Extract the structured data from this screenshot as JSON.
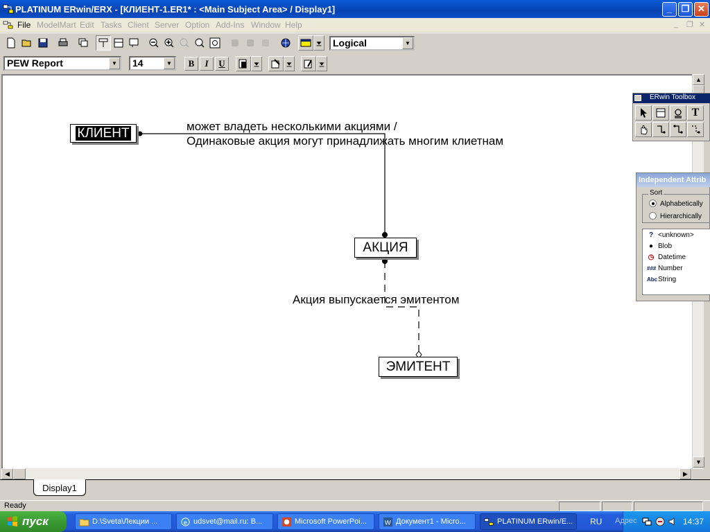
{
  "window": {
    "title": "PLATINUM ERwin/ERX - [КЛИЕНТ-1.ER1* : <Main Subject Area> / Display1]",
    "buttons": {
      "minimize": "_",
      "restore": "❐",
      "close": "✕"
    }
  },
  "menu": {
    "items": [
      "File",
      "ModelMart",
      "Edit",
      "Tasks",
      "Client",
      "Server",
      "Option",
      "Add-Ins",
      "Window",
      "Help"
    ],
    "active_index": 0
  },
  "toolbar": {
    "view_level": "Logical"
  },
  "format_toolbar": {
    "font_name": "PEW Report",
    "font_size": "14",
    "bold": "B",
    "italic": "I",
    "underline": "U"
  },
  "diagram": {
    "entities": [
      {
        "name": "КЛИЕНТ",
        "selected": true
      },
      {
        "name": "АКЦИЯ",
        "selected": false
      },
      {
        "name": "ЭМИТЕНТ",
        "selected": false
      }
    ],
    "relationships": [
      {
        "label_line1": "может владеть несколькими акциями /",
        "label_line2": "Одинаковые акция могут принадлижать многим клиетнам"
      },
      {
        "label_line1": "Акция выпускается эмитентом"
      }
    ]
  },
  "tabs": {
    "display": "Display1"
  },
  "status": {
    "text": "Ready"
  },
  "toolbox": {
    "title": "ERwin Toolbox",
    "text_tool": "T"
  },
  "attr_palette": {
    "title": "Independent Attrib",
    "sort_label": "Sort",
    "options": [
      "Alphabetically",
      "Hierarchically"
    ],
    "selected_option": 0,
    "domains": [
      {
        "icon": "?",
        "label": "<unknown>"
      },
      {
        "icon": "●",
        "label": "Blob"
      },
      {
        "icon": "◷",
        "label": "Datetime"
      },
      {
        "icon": "###",
        "label": "Number"
      },
      {
        "icon": "Abc",
        "label": "String"
      }
    ]
  },
  "taskbar": {
    "start_label": "пуск",
    "tasks": [
      {
        "label": "D:\\Sveta\\Лекции ...",
        "active": false
      },
      {
        "label": "udsvet@mail.ru: В...",
        "active": false
      },
      {
        "label": "Microsoft PowerPoi...",
        "active": false
      },
      {
        "label": "Документ1 - Micro...",
        "active": false
      },
      {
        "label": "PLATINUM ERwin/E...",
        "active": true
      }
    ],
    "language": "RU",
    "address_label": "Адрес",
    "clock": "14:37"
  },
  "colors": {
    "title_bar": "#0842b0",
    "selection": "#000000",
    "taskbar": "#245edb",
    "start_button": "#3a9a32"
  }
}
